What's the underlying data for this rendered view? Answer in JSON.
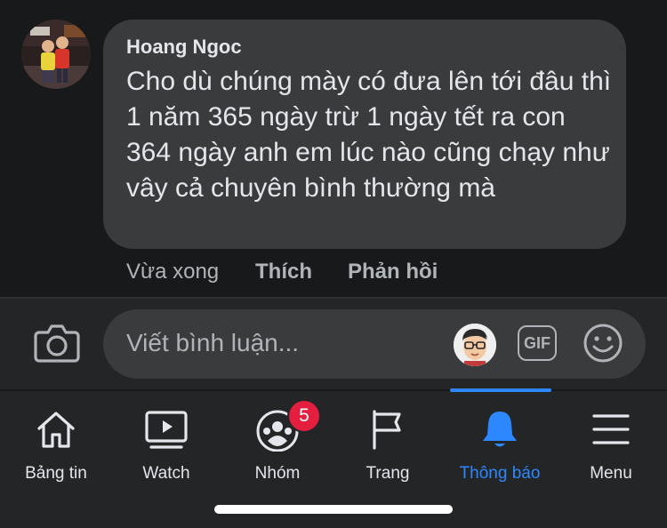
{
  "comment": {
    "author": "Hoang Ngoc",
    "text": "Cho dù chúng mày có đưa lên tới đâu thì 1 năm 365 ngày trừ 1 ngày tết ra con 364 ngày anh em lúc nào cũng chạy như vây cả chuyên bình thường mà",
    "time": "Vừa xong",
    "like_label": "Thích",
    "reply_label": "Phản hồi"
  },
  "composer": {
    "placeholder": "Viết bình luận...",
    "gif_label": "GIF"
  },
  "tabs": [
    {
      "label": "Bảng tin",
      "icon": "home-icon"
    },
    {
      "label": "Watch",
      "icon": "watch-icon"
    },
    {
      "label": "Nhóm",
      "icon": "groups-icon",
      "badge": "5"
    },
    {
      "label": "Trang",
      "icon": "flag-icon"
    },
    {
      "label": "Thông báo",
      "icon": "bell-icon",
      "active": true
    },
    {
      "label": "Menu",
      "icon": "menu-icon"
    }
  ],
  "colors": {
    "accent": "#2d88ff",
    "badge": "#e41e3f",
    "background": "#18191a",
    "bubble": "#3a3b3c"
  }
}
